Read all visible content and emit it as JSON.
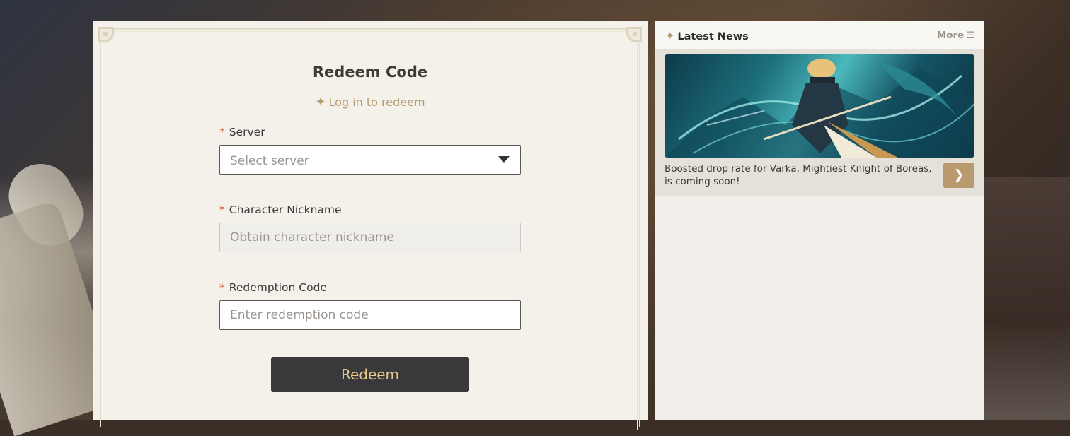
{
  "redeem": {
    "title": "Redeem Code",
    "login_link": "Log in to redeem",
    "required_mark": "*",
    "server": {
      "label": "Server",
      "placeholder": "Select server"
    },
    "nickname": {
      "label": "Character Nickname",
      "placeholder": "Obtain character nickname"
    },
    "code": {
      "label": "Redemption Code",
      "placeholder": "Enter redemption code"
    },
    "button_label": "Redeem"
  },
  "news": {
    "title": "Latest News",
    "more_label": "More",
    "items": [
      {
        "text": "Boosted drop rate for Varka, Mightiest Knight of Boreas, is coming soon!"
      }
    ]
  },
  "icons": {
    "star": "sparkle-icon",
    "more": "menu-icon",
    "arrow": "chevron-right-icon",
    "dropdown": "caret-down-icon"
  },
  "colors": {
    "accent_gold": "#b49a6e",
    "button_dark": "#39393b",
    "button_text": "#e8c88a",
    "required": "#d94a2c"
  }
}
